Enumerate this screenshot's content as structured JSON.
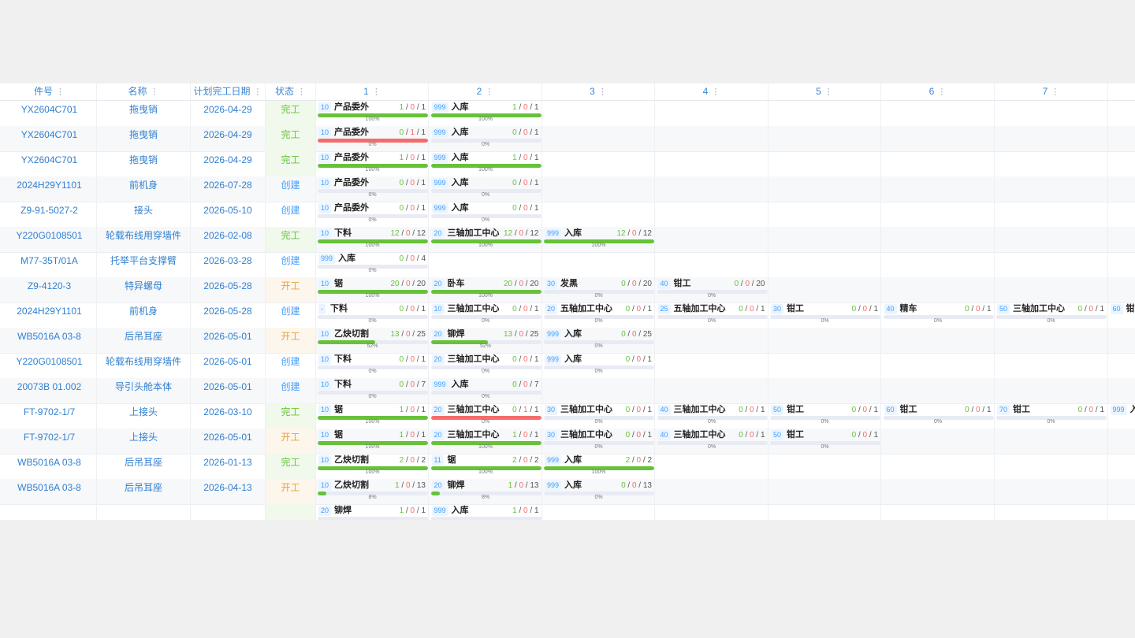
{
  "columns": [
    "件号",
    "名称",
    "计划完工日期",
    "状态",
    "1",
    "2",
    "3",
    "4",
    "5",
    "6",
    "7"
  ],
  "col_dots": "⋮",
  "rows": [
    {
      "part": "YX2604C701",
      "name": "拖曳销",
      "date": "2026-04-29",
      "status": "完工",
      "stype": "done",
      "procs": [
        {
          "code": "10",
          "name": "产品委外",
          "done": "1",
          "bad": "0",
          "total": "1",
          "progress": 1,
          "pct": "100%"
        },
        {
          "code": "999",
          "name": "入库",
          "done": "1",
          "bad": "0",
          "total": "1",
          "progress": 1,
          "pct": "100%"
        }
      ]
    },
    {
      "part": "YX2604C701",
      "name": "拖曳销",
      "date": "2026-04-29",
      "status": "完工",
      "stype": "done",
      "procs": [
        {
          "code": "10",
          "name": "产品委外",
          "done": "0",
          "bad": "1",
          "total": "1",
          "progress": 1,
          "pct": "0%",
          "red": true
        },
        {
          "code": "999",
          "name": "入库",
          "done": "0",
          "bad": "0",
          "total": "1",
          "progress": 0,
          "pct": "0%"
        }
      ]
    },
    {
      "part": "YX2604C701",
      "name": "拖曳销",
      "date": "2026-04-29",
      "status": "完工",
      "stype": "done",
      "procs": [
        {
          "code": "10",
          "name": "产品委外",
          "done": "1",
          "bad": "0",
          "total": "1",
          "progress": 1,
          "pct": "100%"
        },
        {
          "code": "999",
          "name": "入库",
          "done": "1",
          "bad": "0",
          "total": "1",
          "progress": 1,
          "pct": "100%"
        }
      ]
    },
    {
      "part": "2024H29Y1101",
      "name": "前机身",
      "date": "2026-07-28",
      "status": "创建",
      "stype": "create",
      "procs": [
        {
          "code": "10",
          "name": "产品委外",
          "done": "0",
          "bad": "0",
          "total": "1",
          "progress": 0,
          "pct": "0%"
        },
        {
          "code": "999",
          "name": "入库",
          "done": "0",
          "bad": "0",
          "total": "1",
          "progress": 0,
          "pct": "0%"
        }
      ]
    },
    {
      "part": "Z9-91-5027-2",
      "name": "接头",
      "date": "2026-05-10",
      "status": "创建",
      "stype": "create",
      "procs": [
        {
          "code": "10",
          "name": "产品委外",
          "done": "0",
          "bad": "0",
          "total": "1",
          "progress": 0,
          "pct": "0%"
        },
        {
          "code": "999",
          "name": "入库",
          "done": "0",
          "bad": "0",
          "total": "1",
          "progress": 0,
          "pct": "0%"
        }
      ]
    },
    {
      "part": "Y220G0108501",
      "name": "轮载布线用穿墙件",
      "date": "2026-02-08",
      "status": "完工",
      "stype": "done",
      "procs": [
        {
          "code": "10",
          "name": "下料",
          "done": "12",
          "bad": "0",
          "total": "12",
          "progress": 1,
          "pct": "100%"
        },
        {
          "code": "20",
          "name": "三轴加工中心",
          "done": "12",
          "bad": "0",
          "total": "12",
          "progress": 1,
          "pct": "100%"
        },
        {
          "code": "999",
          "name": "入库",
          "done": "12",
          "bad": "0",
          "total": "12",
          "progress": 1,
          "pct": "100%"
        }
      ]
    },
    {
      "part": "M77-35T/01A",
      "name": "托举平台支撑臂",
      "date": "2026-03-28",
      "status": "创建",
      "stype": "create",
      "procs": [
        {
          "code": "999",
          "name": "入库",
          "done": "0",
          "bad": "0",
          "total": "4",
          "progress": 0,
          "pct": "0%"
        }
      ]
    },
    {
      "part": "Z9-4120-3",
      "name": "特异螺母",
      "date": "2026-05-28",
      "status": "开工",
      "stype": "work",
      "procs": [
        {
          "code": "10",
          "name": "锯",
          "done": "20",
          "bad": "0",
          "total": "20",
          "progress": 1,
          "pct": "100%"
        },
        {
          "code": "20",
          "name": "卧车",
          "done": "20",
          "bad": "0",
          "total": "20",
          "progress": 1,
          "pct": "100%"
        },
        {
          "code": "30",
          "name": "发黑",
          "done": "0",
          "bad": "0",
          "total": "20",
          "progress": 0,
          "pct": "0%"
        },
        {
          "code": "40",
          "name": "钳工",
          "done": "0",
          "bad": "0",
          "total": "20",
          "progress": 0,
          "pct": "0%"
        }
      ]
    },
    {
      "part": "2024H29Y1101",
      "name": "前机身",
      "date": "2026-05-28",
      "status": "创建",
      "stype": "create",
      "procs": [
        {
          "code": "-",
          "name": "下料",
          "done": "0",
          "bad": "0",
          "total": "1",
          "progress": 0,
          "pct": "0%"
        },
        {
          "code": "10",
          "name": "三轴加工中心",
          "done": "0",
          "bad": "0",
          "total": "1",
          "progress": 0,
          "pct": "0%"
        },
        {
          "code": "20",
          "name": "五轴加工中心",
          "done": "0",
          "bad": "0",
          "total": "1",
          "progress": 0,
          "pct": "0%"
        },
        {
          "code": "25",
          "name": "五轴加工中心",
          "done": "0",
          "bad": "0",
          "total": "1",
          "progress": 0,
          "pct": "0%"
        },
        {
          "code": "30",
          "name": "钳工",
          "done": "0",
          "bad": "0",
          "total": "1",
          "progress": 0,
          "pct": "0%"
        },
        {
          "code": "40",
          "name": "精车",
          "done": "0",
          "bad": "0",
          "total": "1",
          "progress": 0,
          "pct": "0%"
        },
        {
          "code": "50",
          "name": "三轴加工中心",
          "done": "0",
          "bad": "0",
          "total": "1",
          "progress": 0,
          "pct": "0%"
        },
        {
          "code": "60",
          "name": "钳工",
          "done": "",
          "bad": "",
          "total": "",
          "progress": 0,
          "pct": ""
        }
      ]
    },
    {
      "part": "WB5016A 03-8",
      "name": "后吊耳座",
      "date": "2026-05-01",
      "status": "开工",
      "stype": "work",
      "procs": [
        {
          "code": "10",
          "name": "乙炔切割",
          "done": "13",
          "bad": "0",
          "total": "25",
          "progress": 0.52,
          "pct": "52%"
        },
        {
          "code": "20",
          "name": "铆焊",
          "done": "13",
          "bad": "0",
          "total": "25",
          "progress": 0.52,
          "pct": "52%"
        },
        {
          "code": "999",
          "name": "入库",
          "done": "0",
          "bad": "0",
          "total": "25",
          "progress": 0,
          "pct": "0%"
        }
      ]
    },
    {
      "part": "Y220G0108501",
      "name": "轮载布线用穿墙件",
      "date": "2026-05-01",
      "status": "创建",
      "stype": "create",
      "procs": [
        {
          "code": "10",
          "name": "下料",
          "done": "0",
          "bad": "0",
          "total": "1",
          "progress": 0,
          "pct": "0%"
        },
        {
          "code": "20",
          "name": "三轴加工中心",
          "done": "0",
          "bad": "0",
          "total": "1",
          "progress": 0,
          "pct": "0%"
        },
        {
          "code": "999",
          "name": "入库",
          "done": "0",
          "bad": "0",
          "total": "1",
          "progress": 0,
          "pct": "0%"
        }
      ]
    },
    {
      "part": "20073B 01.002",
      "name": "导引头舱本体",
      "date": "2026-05-01",
      "status": "创建",
      "stype": "create",
      "procs": [
        {
          "code": "10",
          "name": "下料",
          "done": "0",
          "bad": "0",
          "total": "7",
          "progress": 0,
          "pct": "0%"
        },
        {
          "code": "999",
          "name": "入库",
          "done": "0",
          "bad": "0",
          "total": "7",
          "progress": 0,
          "pct": "0%"
        }
      ]
    },
    {
      "part": "FT-9702-1/7",
      "name": "上接头",
      "date": "2026-03-10",
      "status": "完工",
      "stype": "done",
      "procs": [
        {
          "code": "10",
          "name": "锯",
          "done": "1",
          "bad": "0",
          "total": "1",
          "progress": 1,
          "pct": "100%"
        },
        {
          "code": "20",
          "name": "三轴加工中心",
          "done": "0",
          "bad": "1",
          "total": "1",
          "progress": 1,
          "pct": "0%",
          "red": true
        },
        {
          "code": "30",
          "name": "三轴加工中心",
          "done": "0",
          "bad": "0",
          "total": "1",
          "progress": 0,
          "pct": "0%"
        },
        {
          "code": "40",
          "name": "三轴加工中心",
          "done": "0",
          "bad": "0",
          "total": "1",
          "progress": 0,
          "pct": "0%"
        },
        {
          "code": "50",
          "name": "钳工",
          "done": "0",
          "bad": "0",
          "total": "1",
          "progress": 0,
          "pct": "0%"
        },
        {
          "code": "60",
          "name": "钳工",
          "done": "0",
          "bad": "0",
          "total": "1",
          "progress": 0,
          "pct": "0%"
        },
        {
          "code": "70",
          "name": "钳工",
          "done": "0",
          "bad": "0",
          "total": "1",
          "progress": 0,
          "pct": "0%"
        },
        {
          "code": "999",
          "name": "入",
          "done": "",
          "bad": "",
          "total": "",
          "progress": 0,
          "pct": ""
        }
      ]
    },
    {
      "part": "FT-9702-1/7",
      "name": "上接头",
      "date": "2026-05-01",
      "status": "开工",
      "stype": "work",
      "procs": [
        {
          "code": "10",
          "name": "锯",
          "done": "1",
          "bad": "0",
          "total": "1",
          "progress": 1,
          "pct": "100%"
        },
        {
          "code": "20",
          "name": "三轴加工中心",
          "done": "1",
          "bad": "0",
          "total": "1",
          "progress": 1,
          "pct": "100%"
        },
        {
          "code": "30",
          "name": "三轴加工中心",
          "done": "0",
          "bad": "0",
          "total": "1",
          "progress": 0,
          "pct": "0%"
        },
        {
          "code": "40",
          "name": "三轴加工中心",
          "done": "0",
          "bad": "0",
          "total": "1",
          "progress": 0,
          "pct": "0%"
        },
        {
          "code": "50",
          "name": "钳工",
          "done": "0",
          "bad": "0",
          "total": "1",
          "progress": 0,
          "pct": "0%"
        }
      ]
    },
    {
      "part": "WB5016A 03-8",
      "name": "后吊耳座",
      "date": "2026-01-13",
      "status": "完工",
      "stype": "done",
      "procs": [
        {
          "code": "10",
          "name": "乙炔切割",
          "done": "2",
          "bad": "0",
          "total": "2",
          "progress": 1,
          "pct": "100%"
        },
        {
          "code": "11",
          "name": "锯",
          "done": "2",
          "bad": "0",
          "total": "2",
          "progress": 1,
          "pct": "100%"
        },
        {
          "code": "999",
          "name": "入库",
          "done": "2",
          "bad": "0",
          "total": "2",
          "progress": 1,
          "pct": "100%"
        }
      ]
    },
    {
      "part": "WB5016A 03-8",
      "name": "后吊耳座",
      "date": "2026-04-13",
      "status": "开工",
      "stype": "work",
      "procs": [
        {
          "code": "10",
          "name": "乙炔切割",
          "done": "1",
          "bad": "0",
          "total": "13",
          "progress": 0.08,
          "pct": "8%"
        },
        {
          "code": "20",
          "name": "铆焊",
          "done": "1",
          "bad": "0",
          "total": "13",
          "progress": 0.08,
          "pct": "8%"
        },
        {
          "code": "999",
          "name": "入库",
          "done": "0",
          "bad": "0",
          "total": "13",
          "progress": 0,
          "pct": "0%"
        }
      ]
    },
    {
      "part": "",
      "name": "",
      "date": "",
      "status": "",
      "stype": "done",
      "procs": [
        {
          "code": "20",
          "name": "铆焊",
          "done": "1",
          "bad": "0",
          "total": "1",
          "progress": 0,
          "pct": ""
        },
        {
          "code": "999",
          "name": "入库",
          "done": "1",
          "bad": "0",
          "total": "1",
          "progress": 0,
          "pct": ""
        }
      ]
    }
  ]
}
